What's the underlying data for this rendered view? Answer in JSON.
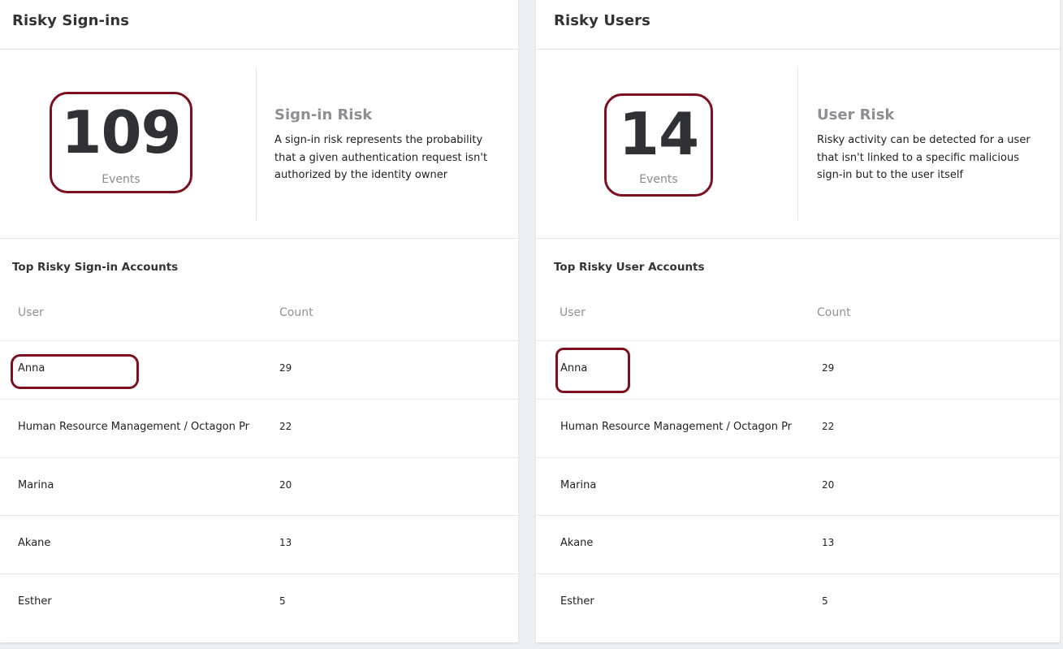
{
  "left": {
    "title": "Risky Sign-ins",
    "stat": {
      "value": "109",
      "label": "Events"
    },
    "risk_title": "Sign-in Risk",
    "risk_desc": "A sign-in risk represents the probability that a given authentication request isn't authorized by the identity owner",
    "section_title": "Top Risky Sign-in Accounts",
    "columns": {
      "user": "User",
      "count": "Count"
    },
    "rows": [
      {
        "user": "Anna",
        "count": "29"
      },
      {
        "user": "Human Resource Management / Octagon Pr",
        "count": "22"
      },
      {
        "user": "Marina",
        "count": "20"
      },
      {
        "user": "Akane",
        "count": "13"
      },
      {
        "user": "Esther",
        "count": "5"
      }
    ]
  },
  "right": {
    "title": "Risky Users",
    "stat": {
      "value": "14",
      "label": "Events"
    },
    "risk_title": "User Risk",
    "risk_desc": "Risky activity can be detected for a user that isn't linked to a specific malicious sign-in but to the user itself",
    "section_title": "Top Risky User Accounts",
    "columns": {
      "user": "User",
      "count": "Count"
    },
    "rows": [
      {
        "user": "Anna",
        "count": "29"
      },
      {
        "user": "Human Resource Management / Octagon Pr",
        "count": "22"
      },
      {
        "user": "Marina",
        "count": "20"
      },
      {
        "user": "Akane",
        "count": "13"
      },
      {
        "user": "Esther",
        "count": "5"
      }
    ]
  },
  "colors": {
    "highlight": "#7c1020",
    "stat_number": "#2f3135",
    "muted": "#8d8f93"
  }
}
